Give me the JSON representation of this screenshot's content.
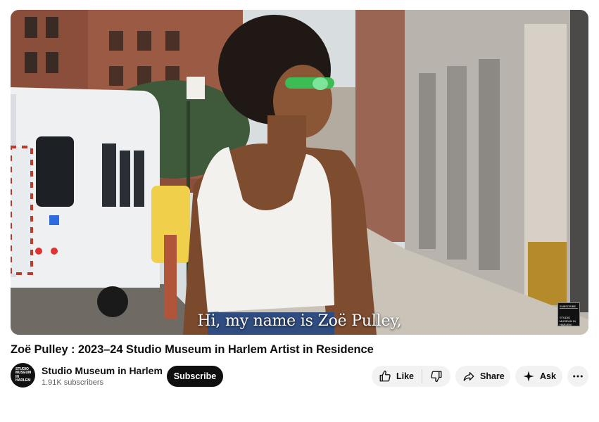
{
  "video": {
    "subtitle": "Hi, my name is Zoë Pulley,",
    "watermark_top": "SUBSCRIBE",
    "watermark_logo": "STUDIO MUSEUM IN HARLEM"
  },
  "title": "Zoë Pulley : 2023–24 Studio Museum in Harlem Artist in Residence",
  "channel": {
    "avatar_text": "STUDIO MUSEUM IN HARLEM",
    "name": "Studio Museum in Harlem",
    "subscribers": "1.91K subscribers"
  },
  "actions": {
    "subscribe": "Subscribe",
    "like": "Like",
    "share": "Share",
    "ask": "Ask"
  },
  "icons": {
    "like": "thumbs-up-icon",
    "dislike": "thumbs-down-icon",
    "share": "share-arrow-icon",
    "ask": "sparkle-icon",
    "more": "more-horizontal-icon"
  }
}
